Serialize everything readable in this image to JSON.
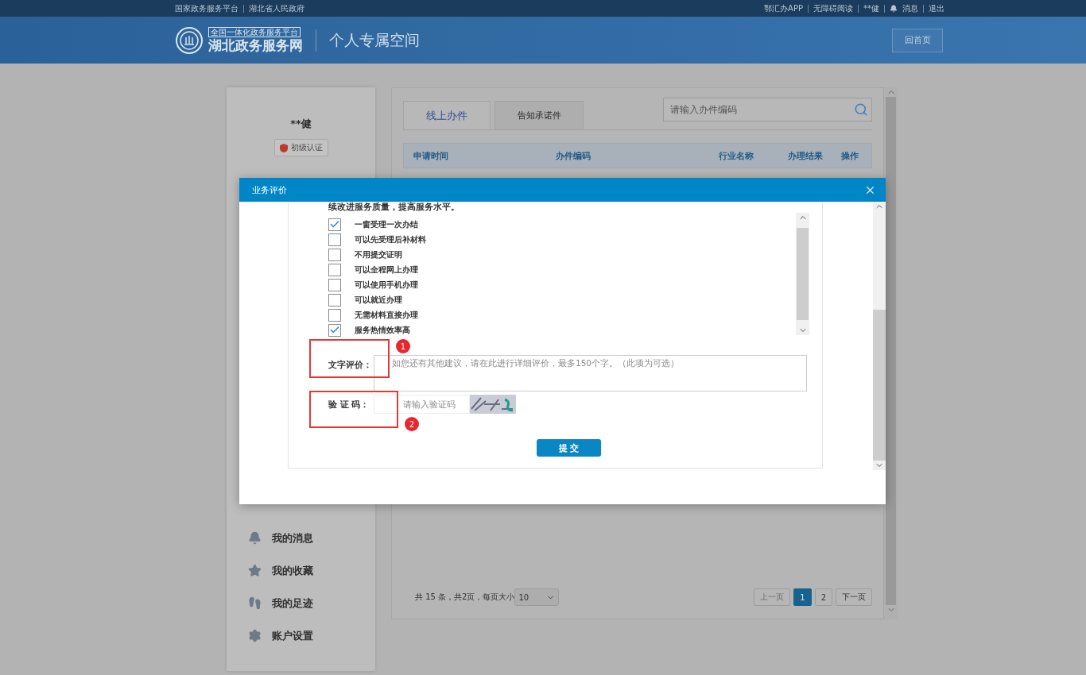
{
  "top_bar": {
    "left_links": [
      "国家政务服务平台",
      "湖北省人民政府"
    ],
    "right_links": [
      {
        "kind": "link",
        "label": "鄂汇办APP"
      },
      {
        "kind": "link",
        "label": "无障碍阅读"
      },
      {
        "kind": "link",
        "label": "**健"
      },
      {
        "kind": "bell",
        "label": "消息"
      },
      {
        "kind": "link",
        "label": "退出"
      }
    ]
  },
  "header": {
    "logo_caption": "全国一体化政务服务平台",
    "logo_title": "湖北政务服务网",
    "page_title": "个人专属空间",
    "home_button": "回首页"
  },
  "sidebar": {
    "user_name": "**健",
    "badge": "初级认证",
    "menu": [
      {
        "kind": "bell",
        "label": "我的消息"
      },
      {
        "kind": "star",
        "label": "我的收藏"
      },
      {
        "kind": "footprint",
        "label": "我的足迹"
      },
      {
        "kind": "gear",
        "label": "账户设置"
      }
    ]
  },
  "main": {
    "tabs": [
      {
        "label": "线上办件",
        "selected": true
      },
      {
        "label": "告知承诺件",
        "selected": false
      }
    ],
    "search": {
      "placeholder": "请输入办件编码"
    },
    "table": {
      "columns": [
        "申请时间",
        "办件编码",
        "行业名称",
        "办理结果",
        "操作"
      ]
    },
    "pagination": {
      "summary": "共 15 条，共2页，每页大小",
      "page_size": "10",
      "buttons": [
        {
          "label": "上一页",
          "disabled": true,
          "selected": false
        },
        {
          "label": "1",
          "disabled": false,
          "selected": true
        },
        {
          "label": "2",
          "disabled": false,
          "selected": false
        },
        {
          "label": "下一页",
          "disabled": false,
          "selected": false
        }
      ]
    }
  },
  "dialog": {
    "title": "业务评价",
    "intro": "续改进服务质量，提高服务水平。",
    "options": [
      {
        "label": "一窗受理一次办结",
        "checked": true
      },
      {
        "label": "可以先受理后补材料",
        "checked": false
      },
      {
        "label": "不用提交证明",
        "checked": false
      },
      {
        "label": "可以全程网上办理",
        "checked": false
      },
      {
        "label": "可以使用手机办理",
        "checked": false
      },
      {
        "label": "可以就近办理",
        "checked": false
      },
      {
        "label": "无需材料直接办理",
        "checked": false
      },
      {
        "label": "服务热情效率高",
        "checked": true
      }
    ],
    "comment": {
      "label": "文字评价：",
      "placeholder": "如您还有其他建议，请在此进行详细评价，最多150个字。（此项为可选）"
    },
    "captcha": {
      "label": "验 证 码：",
      "placeholder": "请输入验证码"
    },
    "submit": "提 交"
  },
  "annotations": [
    {
      "label": "1"
    },
    {
      "label": "2"
    }
  ]
}
